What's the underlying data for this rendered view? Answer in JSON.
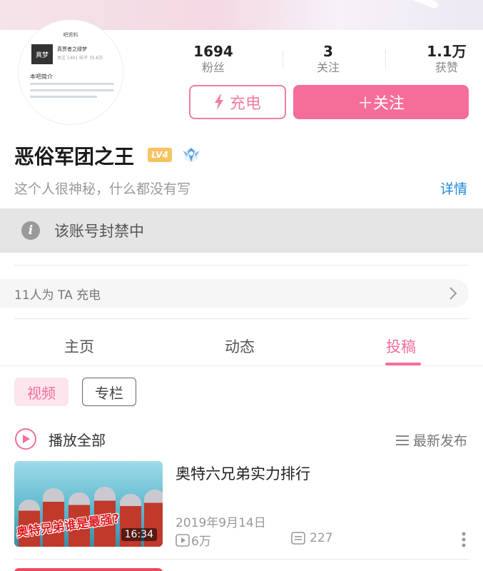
{
  "profile": {
    "avatar_text": {
      "header": "吧资料",
      "name": "真贾者之绿梦",
      "stats": "关注 1401 帖子 35.6万",
      "section": "本吧简介",
      "logo": "真梦"
    },
    "username": "恶俗军团之王",
    "level": "LV4",
    "bio": "这个人很神秘，什么都没有写",
    "detail_link": "详情"
  },
  "stats": [
    {
      "value": "1694",
      "label": "粉丝"
    },
    {
      "value": "3",
      "label": "关注"
    },
    {
      "value": "1.1万",
      "label": "获赞"
    }
  ],
  "buttons": {
    "charge": "充电",
    "follow": "＋关注"
  },
  "banned_notice": "该账号封禁中",
  "charge_row": "11人为 TA 充电",
  "tabs": [
    "主页",
    "动态",
    "投稿"
  ],
  "active_tab": "投稿",
  "chips": [
    "视频",
    "专栏"
  ],
  "play_all": "播放全部",
  "sort": "最新发布",
  "video": {
    "title": "奥特六兄弟实力排行",
    "thumb_caption": "奥特兄弟谁是最强?",
    "duration": "16:34",
    "date": "2019年9月14日",
    "views": "6万",
    "comments": "227"
  },
  "colors": {
    "accent": "#f56e9a",
    "link": "#1e88d9",
    "level": "#f7c363"
  }
}
